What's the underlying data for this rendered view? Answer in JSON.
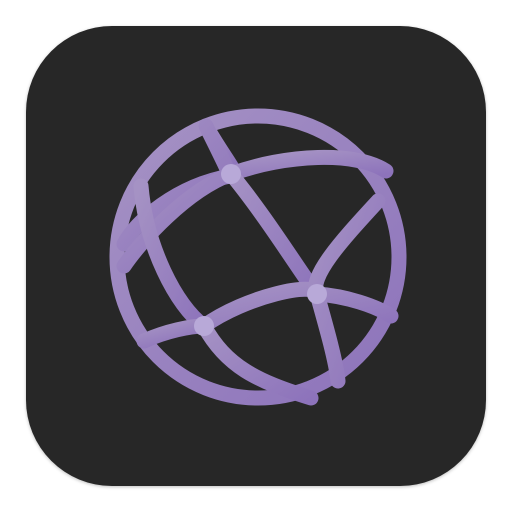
{
  "app_icon": {
    "icon": "globe-network-icon",
    "background_color": "#272727",
    "glyph_color_start": "#a592c4",
    "glyph_color_end": "#8d73bb",
    "node_color": "#b8a9d8"
  }
}
